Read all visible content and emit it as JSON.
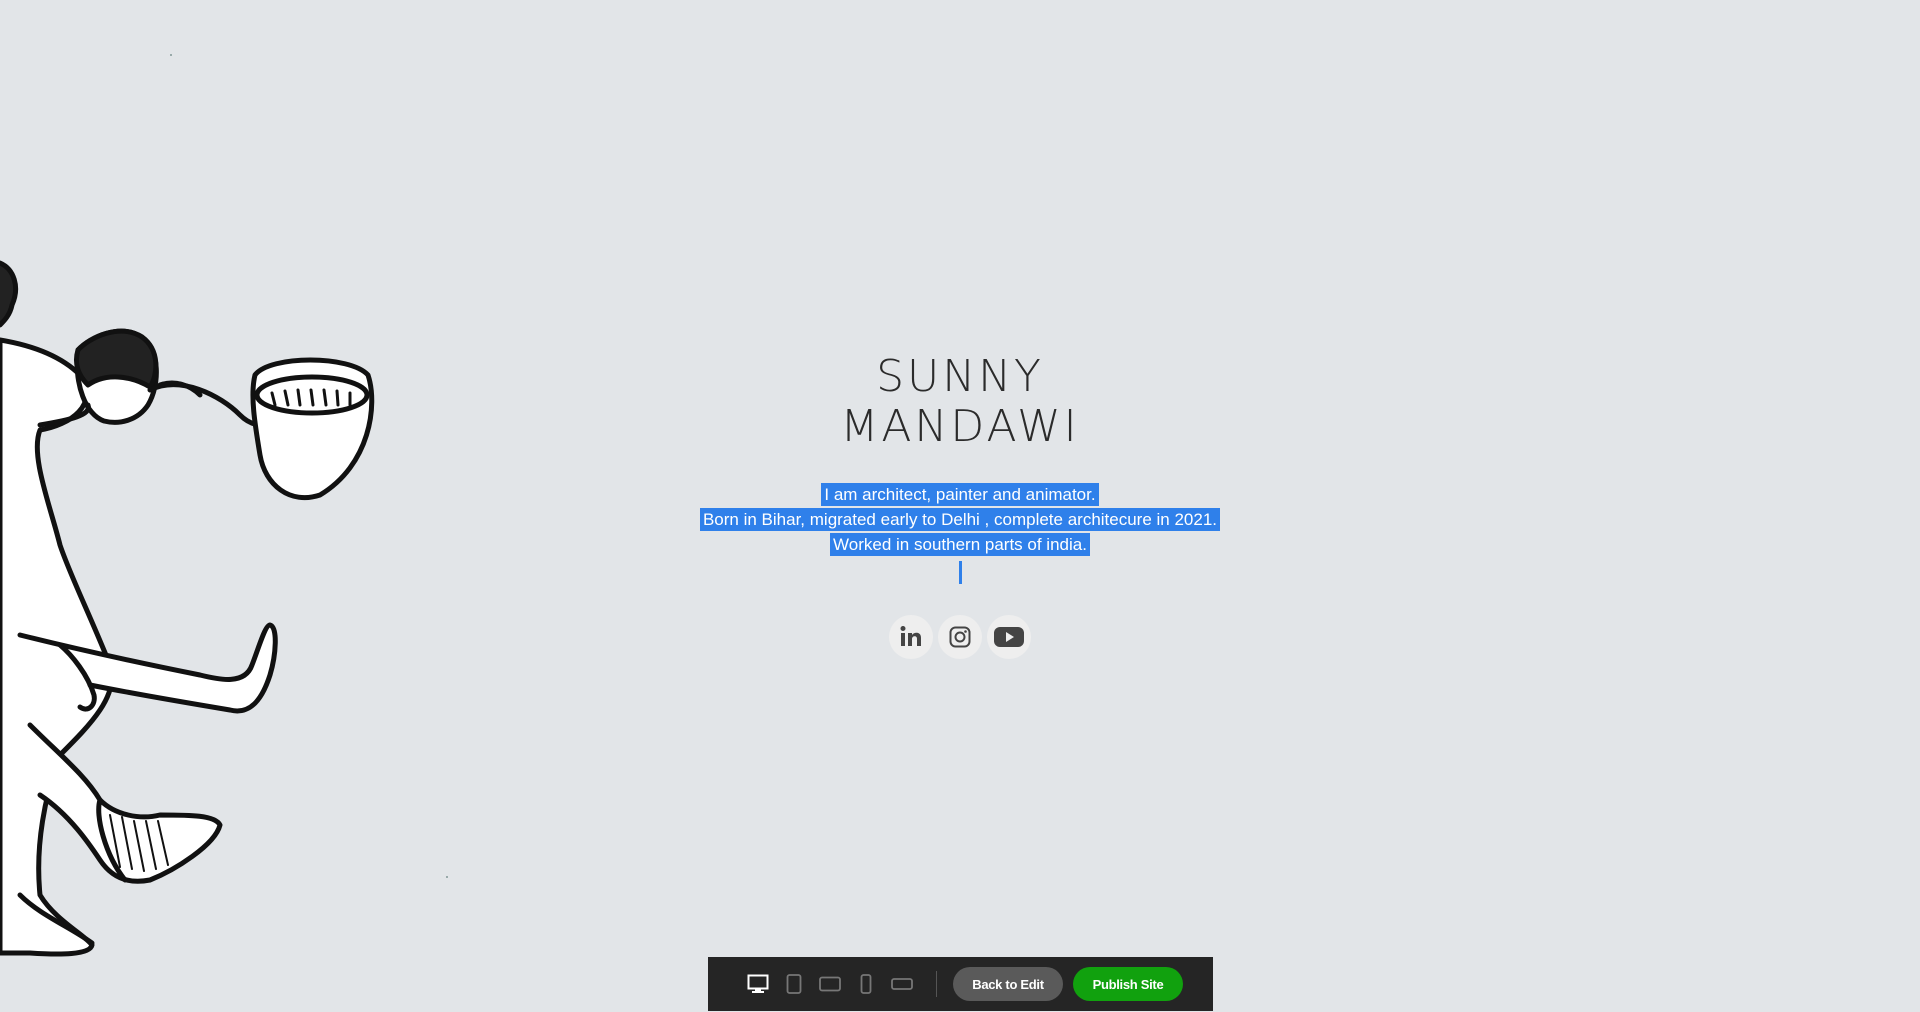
{
  "site": {
    "name_line1": "SUNNY",
    "name_line2": "MANDAWI",
    "bio": [
      "I am architect, painter and animator.",
      "Born in Bihar, migrated early to Delhi , complete architecure in 2021.",
      "Worked in southern parts of india."
    ]
  },
  "social": [
    {
      "icon": "linkedin-icon",
      "label": "in"
    },
    {
      "icon": "instagram-icon"
    },
    {
      "icon": "youtube-icon"
    }
  ],
  "toolbar": {
    "devices": [
      "desktop-icon",
      "tablet-portrait-icon",
      "tablet-landscape-icon",
      "mobile-portrait-icon",
      "mobile-landscape-icon"
    ],
    "back_label": "Back to Edit",
    "publish_label": "Publish Site"
  },
  "colors": {
    "background": "#e2e5e8",
    "selection": "#2f80ea",
    "publish": "#11a10e",
    "toolbar": "#252525"
  }
}
